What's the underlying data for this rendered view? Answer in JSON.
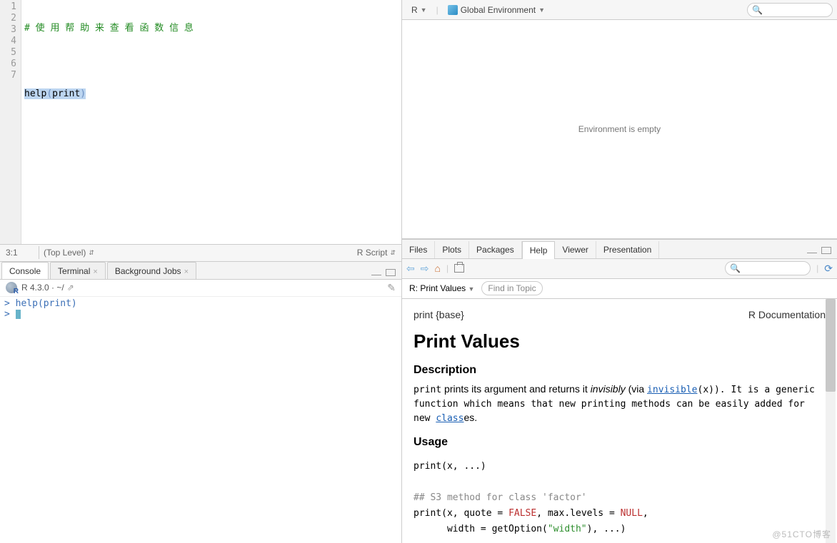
{
  "editor": {
    "lines": [
      "1",
      "2",
      "3",
      "4",
      "5",
      "6",
      "7"
    ],
    "line1_comment": "# 使 用 帮 助 来 查 看 函 数 信 息",
    "line3_func": "help",
    "line3_arg": "print",
    "pos": "3:1",
    "scope": "(Top Level)",
    "lang": "R Script"
  },
  "console_tabs": {
    "console": "Console",
    "terminal": "Terminal",
    "bg": "Background Jobs"
  },
  "console": {
    "version": "R 4.3.0 · ~/",
    "prompt": ">",
    "call": "help(print)"
  },
  "env": {
    "lang": "R",
    "scope": "Global Environment",
    "empty": "Environment is empty",
    "search_ph": ""
  },
  "help_tabs": {
    "files": "Files",
    "plots": "Plots",
    "packages": "Packages",
    "help": "Help",
    "viewer": "Viewer",
    "presentation": "Presentation"
  },
  "help": {
    "title_crumb": "R: Print Values",
    "find_ph": "Find in Topic",
    "pkg": "print {base}",
    "doc": "R Documentation",
    "h1": "Print Values",
    "h2_desc": "Description",
    "desc_pre": "print",
    "desc_1": " prints its argument and returns it ",
    "desc_inv": "invisibly",
    "desc_2": " (via ",
    "desc_link1": "invisible",
    "desc_3": "(x)). It is a generic function which means that new printing methods can be easily added for new ",
    "desc_link2": "class",
    "desc_4": "es.",
    "h2_usage": "Usage",
    "usage1": "print(x, ...)",
    "usage_comment": "## S3 method for class 'factor'",
    "usage2a": "print(x, quote = ",
    "usage2_false": "FALSE",
    "usage2b": ", max.levels = ",
    "usage2_null": "NULL",
    "usage2c": ",",
    "usage3a": "      width = getOption(",
    "usage3_str": "\"width\"",
    "usage3b": "), ...)"
  },
  "watermark": "@51CTO博客"
}
